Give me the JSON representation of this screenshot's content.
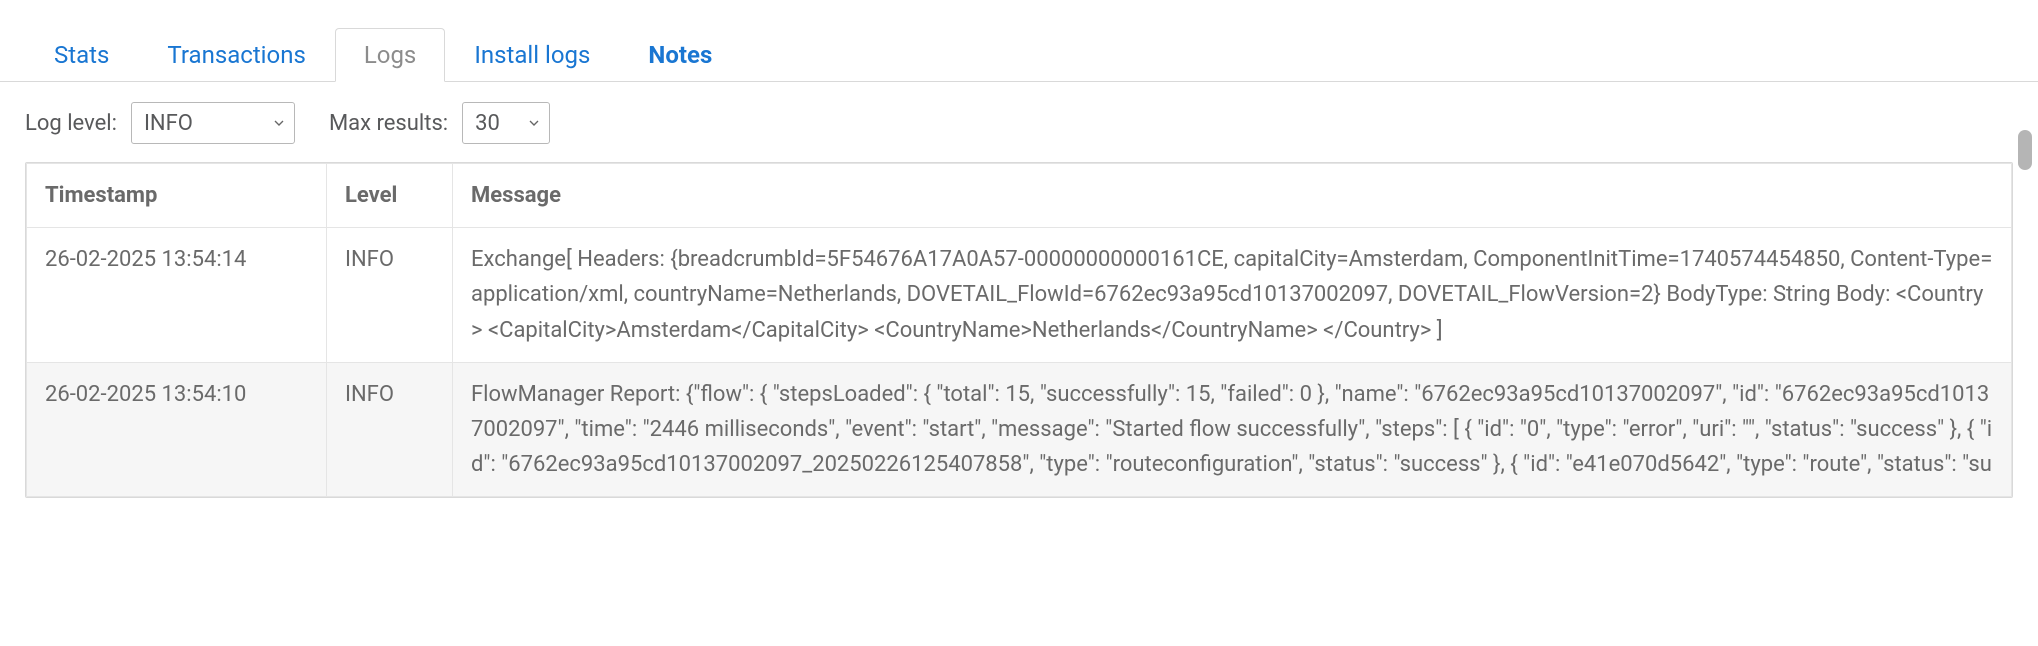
{
  "tabs": {
    "stats": "Stats",
    "transactions": "Transactions",
    "logs": "Logs",
    "install_logs": "Install logs",
    "notes": "Notes"
  },
  "controls": {
    "loglevel_label": "Log level:",
    "loglevel_value": "INFO",
    "maxresults_label": "Max results:",
    "maxresults_value": "30"
  },
  "table": {
    "headers": {
      "timestamp": "Timestamp",
      "level": "Level",
      "message": "Message"
    },
    "rows": [
      {
        "timestamp": "26-02-2025 13:54:14",
        "level": "INFO",
        "message": "Exchange[ Headers: {breadcrumbId=5F54676A17A0A57-00000000000161CE, capitalCity=Amsterdam, ComponentInitTime=1740574454850, Content-Type=application/xml, countryName=Netherlands, DOVETAIL_FlowId=6762ec93a95cd10137002097, DOVETAIL_FlowVersion=2} BodyType: String Body: <Country> <CapitalCity>Amsterdam</CapitalCity> <CountryName>Netherlands</CountryName> </Country> ]"
      },
      {
        "timestamp": "26-02-2025 13:54:10",
        "level": "INFO",
        "message": "FlowManager Report: {\"flow\": { \"stepsLoaded\": { \"total\": 15, \"successfully\": 15, \"failed\": 0 }, \"name\": \"6762ec93a95cd10137002097\", \"id\": \"6762ec93a95cd10137002097\", \"time\": \"2446 milliseconds\", \"event\": \"start\", \"message\": \"Started flow successfully\", \"steps\": [ { \"id\": \"0\", \"type\": \"error\", \"uri\": \"\", \"status\": \"success\" }, { \"id\": \"6762ec93a95cd10137002097_20250226125407858\", \"type\": \"routeconfiguration\", \"status\": \"success\" }, { \"id\": \"e41e070d5642\", \"type\": \"route\", \"status\": \"su"
      }
    ]
  }
}
